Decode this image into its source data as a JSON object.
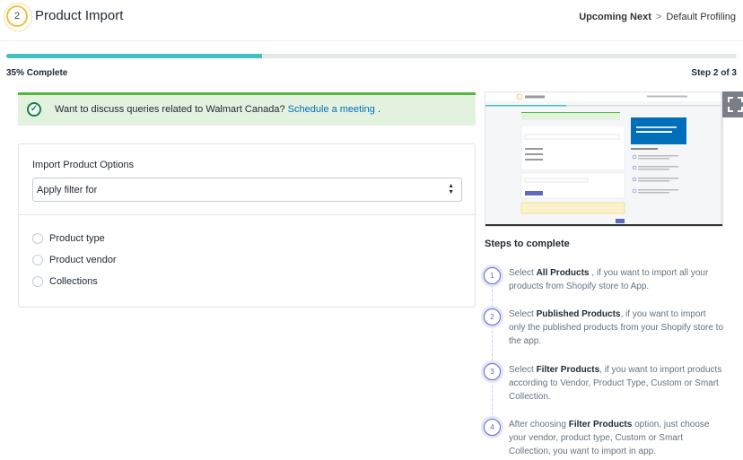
{
  "header": {
    "step_number": "2",
    "title": "Product Import",
    "upcoming_label": "Upcoming Next",
    "upcoming_separator": ">",
    "upcoming_next": "Default Profiling"
  },
  "progress": {
    "percent": 35,
    "label": "35% Complete",
    "step_label": "Step 2 of 3",
    "fill_color": "#47c1bf"
  },
  "banner": {
    "text": "Want to discuss queries related to Walmart Canada?",
    "link": "Schedule a meeting",
    "suffix": ".",
    "accent_color": "#50b83c"
  },
  "import_options": {
    "label": "Import Product Options",
    "select_value": "Apply filter for",
    "radios": [
      {
        "label": "Product type"
      },
      {
        "label": "Product vendor"
      },
      {
        "label": "Collections"
      }
    ]
  },
  "video": {
    "expand_icon": "expand-icon"
  },
  "steps": {
    "title": "Steps to complete",
    "items": [
      {
        "number": "1",
        "pre": "Select ",
        "bold": "All Products",
        "post": " , if you want to import all your products from Shopify store to App."
      },
      {
        "number": "2",
        "pre": "Select ",
        "bold": "Published Products",
        "post": ", if you want to import only the published products from your Shopify store to the app."
      },
      {
        "number": "3",
        "pre": "Select ",
        "bold": "Filter Products",
        "post": ", if you want to import products according to Vendor, Product Type, Custom or Smart Collection."
      },
      {
        "number": "4",
        "pre": "After choosing ",
        "bold": "Filter Products",
        "post": " option, just choose your vendor, product type, Custom or Smart Collection, you want to import in app."
      }
    ]
  }
}
